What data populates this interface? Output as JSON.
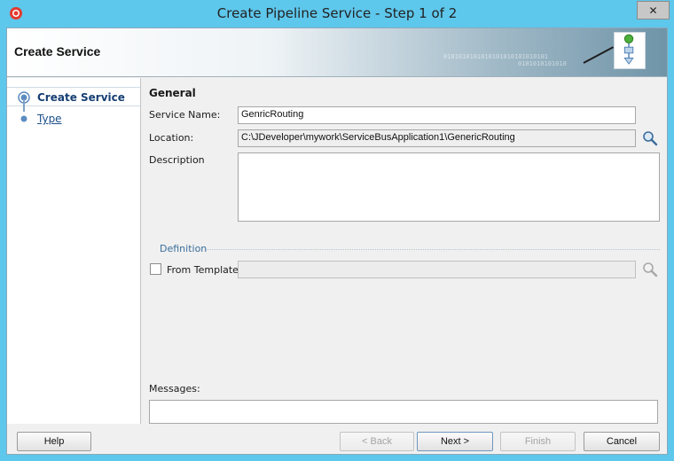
{
  "window": {
    "title": "Create Pipeline Service - Step 1 of 2",
    "close_label": "✕"
  },
  "header": {
    "title": "Create Service",
    "binary_1": "0101010101010101010101010101",
    "binary_2": "0101010101010"
  },
  "steps": [
    {
      "label": "Create Service",
      "active": true
    },
    {
      "label": "Type",
      "active": false
    }
  ],
  "form": {
    "section_title": "General",
    "service_name_label": "Service Name:",
    "service_name_value": "GenricRouting",
    "location_label": "Location:",
    "location_value": "C:\\JDeveloper\\mywork\\ServiceBusApplication1\\GenericRouting",
    "description_label": "Description",
    "definition_label": "Definition",
    "from_template_label": "From Template",
    "template_value": "",
    "messages_label": "Messages:"
  },
  "buttons": {
    "help": "Help",
    "back": "< Back",
    "next": "Next >",
    "finish": "Finish",
    "cancel": "Cancel"
  },
  "icons": {
    "search": "magnifier-icon",
    "step_marker": "radio-step-icon",
    "wizard": "flow-diagram-icon"
  },
  "colors": {
    "title_bar": "#5ec7ec",
    "link": "#1b4f8a"
  }
}
